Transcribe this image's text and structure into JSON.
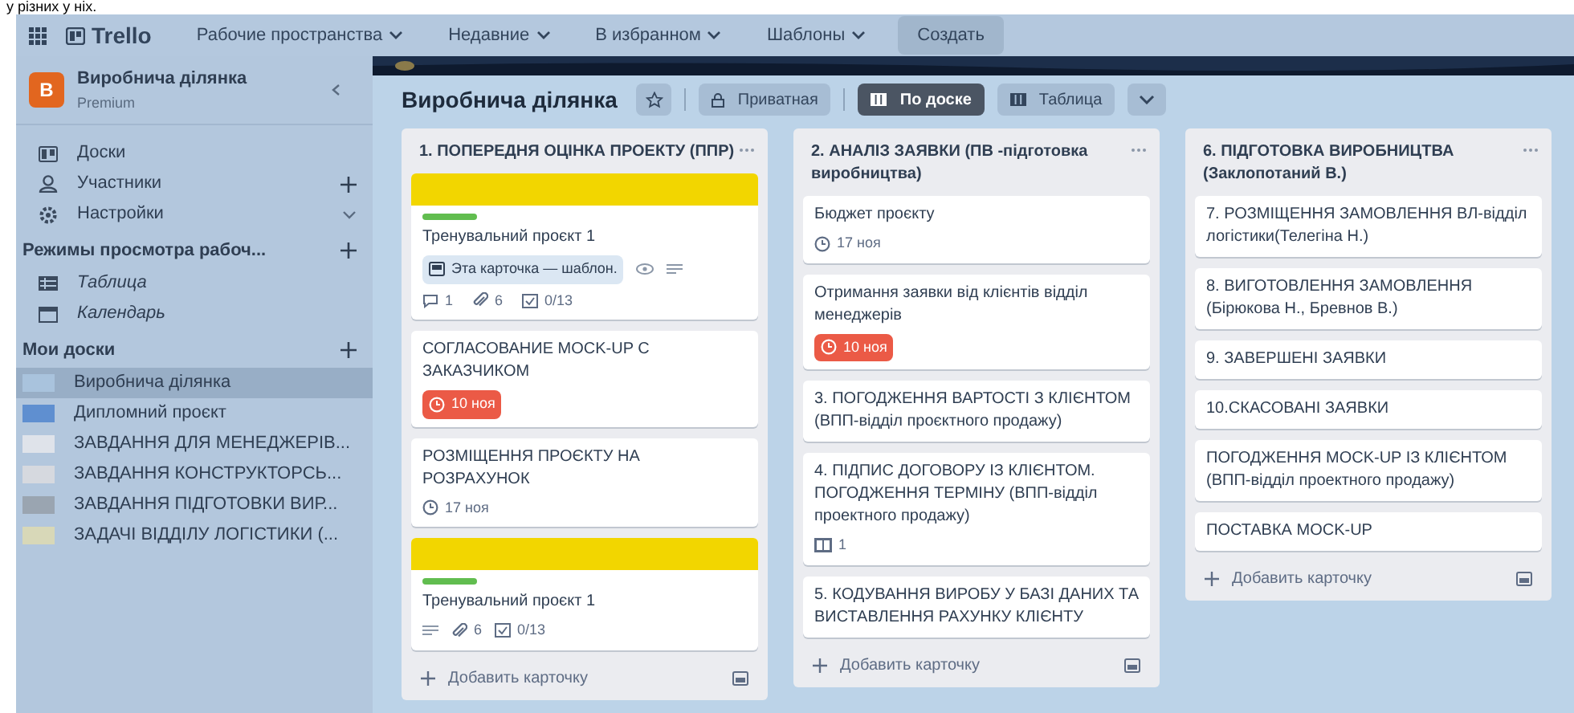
{
  "document_text": "у різних у ніх.",
  "topbar": {
    "logo": "Trello",
    "menus": [
      {
        "label": "Рабочие пространства"
      },
      {
        "label": "Недавние"
      },
      {
        "label": "В избранном"
      },
      {
        "label": "Шаблоны"
      }
    ],
    "create": "Создать"
  },
  "sidebar": {
    "workspace": {
      "initial": "B",
      "name": "Виробнича ділянка",
      "plan": "Premium"
    },
    "items": [
      {
        "label": "Доски"
      },
      {
        "label": "Участники",
        "has_add": true
      },
      {
        "label": "Настройки",
        "has_expand": true
      }
    ],
    "views_heading": "Режимы просмотра рабоч...",
    "views": [
      {
        "label": "Таблица"
      },
      {
        "label": "Календарь"
      }
    ],
    "boards_heading": "Мои доски",
    "boards": [
      {
        "label": "Виробнича ділянка",
        "color": "#a9c3dd",
        "selected": true
      },
      {
        "label": "Дипломний проєкт",
        "color": "#5f8fd0",
        "selected": false
      },
      {
        "label": "ЗАВДАННЯ ДЛЯ МЕНЕДЖЕРІВ...",
        "color": "#dfe3ea",
        "selected": false
      },
      {
        "label": "ЗАВДАННЯ КОНСТРУКТОРСЬ...",
        "color": "#d6d9df",
        "selected": false
      },
      {
        "label": "ЗАВДАННЯ ПІДГОТОВКИ ВИР...",
        "color": "#9aa5b1",
        "selected": false
      },
      {
        "label": "ЗАДАЧІ ВІДДІЛУ ЛОГІСТИКИ (...",
        "color": "#d8d8b8",
        "selected": false
      }
    ]
  },
  "board": {
    "title": "Виробнича ділянка",
    "visibility": "Приватная",
    "views": [
      {
        "label": "По доске",
        "selected": true
      },
      {
        "label": "Таблица",
        "selected": false
      }
    ],
    "lists": [
      {
        "title": "1. ПОПЕРЕДНЯ ОЦІНКА ПРОЕКТУ (ППР)",
        "add_card": "Добавить карточку",
        "cards": [
          {
            "cover": {
              "color": "#f2d600"
            },
            "labels": [
              {
                "color": "#61bd4f"
              }
            ],
            "title": "Тренувальний проєкт 1",
            "badges": [
              {
                "kind": "template",
                "text": "Эта карточка — шаблон."
              },
              {
                "kind": "watch"
              },
              {
                "kind": "description"
              }
            ],
            "badges2": [
              {
                "kind": "comments",
                "text": "1"
              },
              {
                "kind": "attachments",
                "text": "6"
              },
              {
                "kind": "checklist",
                "text": "0/13"
              }
            ]
          },
          {
            "title": "СОГЛАСОВАНИЕ MOCK-UP С ЗАКАЗЧИКОМ",
            "badges": [
              {
                "kind": "due",
                "text": "10 ноя",
                "overdue": true
              }
            ]
          },
          {
            "title": "РОЗМІЩЕННЯ ПРОЄКТУ НА РОЗРАХУНОК",
            "badges": [
              {
                "kind": "due",
                "text": "17 ноя",
                "overdue": false
              }
            ]
          },
          {
            "cover": {
              "color": "#f2d600"
            },
            "labels": [
              {
                "color": "#61bd4f"
              }
            ],
            "title": "Тренувальний проєкт 1",
            "badges": [
              {
                "kind": "description"
              },
              {
                "kind": "attachments",
                "text": "6"
              },
              {
                "kind": "checklist",
                "text": "0/13"
              }
            ]
          }
        ]
      },
      {
        "title": "2. АНАЛІЗ ЗАЯВКИ (ПВ -підготовка виробництва)",
        "add_card": "Добавить карточку",
        "cards": [
          {
            "title": "Бюджет проєкту",
            "badges": [
              {
                "kind": "due",
                "text": "17 ноя",
                "overdue": false
              }
            ]
          },
          {
            "title": "Отримання заявки від клієнтів відділ менеджерів",
            "badges": [
              {
                "kind": "due",
                "text": "10 ноя",
                "overdue": true
              }
            ]
          },
          {
            "title": "3. ПОГОДЖЕННЯ ВАРТОСТІ З КЛІЄНТОМ (ВПП-відділ проєктного продажу)"
          },
          {
            "title": "4. ПІДПИС ДОГОВОРУ ІЗ КЛІЄНТОМ. ПОГОДЖЕННЯ ТЕРМІНУ (ВПП-відділ проектного продажу)",
            "badges": [
              {
                "kind": "board",
                "text": "1"
              }
            ]
          },
          {
            "title": "5. КОДУВАННЯ ВИРОБУ У БАЗІ ДАНИХ ТА ВИСТАВЛЕННЯ РАХУНКУ КЛІЄНТУ"
          }
        ]
      },
      {
        "title": "6. ПІДГОТОВКА ВИРОБНИЦТВА (Заклопотаний В.)",
        "add_card": "Добавить карточку",
        "cards": [
          {
            "title": "7. РОЗМІЩЕННЯ ЗАМОВЛЕННЯ ВЛ-відділ логістики(Телегіна Н.)"
          },
          {
            "title": "8. ВИГОТОВЛЕННЯ ЗАМОВЛЕННЯ (Бірюкова Н., Бревнов В.)"
          },
          {
            "title": "9. ЗАВЕРШЕНІ ЗАЯВКИ"
          },
          {
            "title": "10.СКАСОВАНІ ЗАЯВКИ"
          },
          {
            "title": "ПОГОДЖЕННЯ MOCK-UP ІЗ КЛІЄНТОМ (ВПП-відділ проектного продажу)"
          },
          {
            "title": "ПОСТАВКА MOCK-UP"
          }
        ]
      }
    ]
  }
}
